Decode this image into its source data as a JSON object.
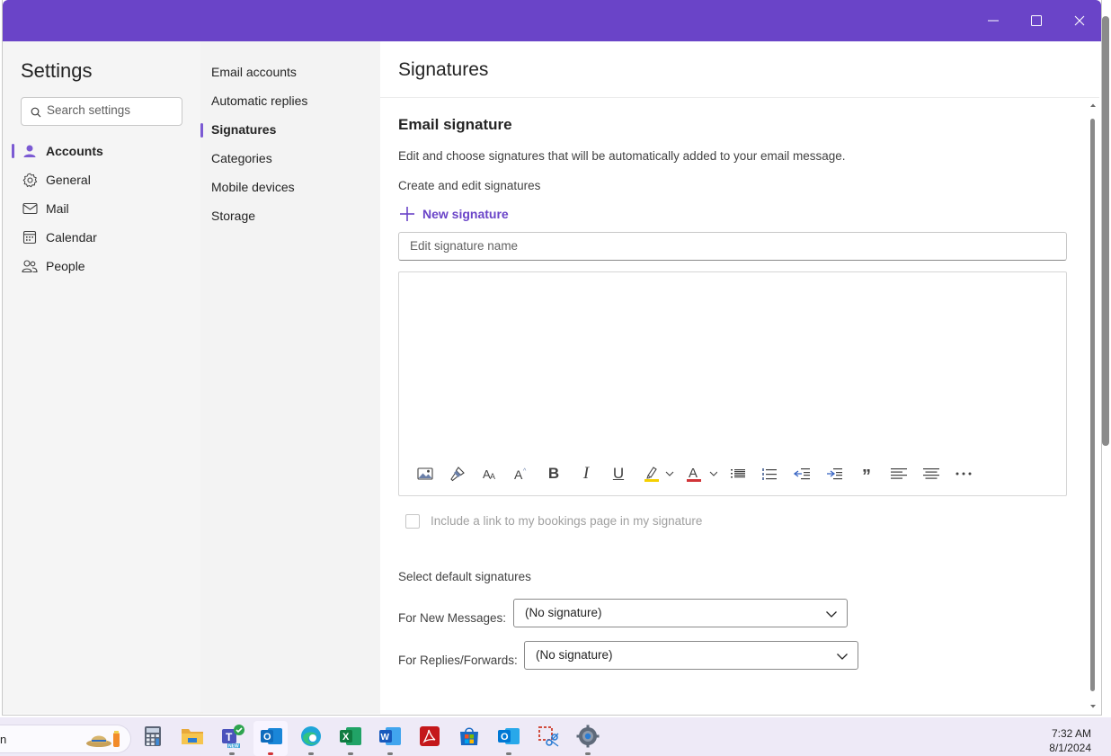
{
  "window": {
    "controls": [
      "minimize",
      "maximize",
      "close"
    ]
  },
  "sidebar": {
    "title": "Settings",
    "search_placeholder": "Search settings",
    "items": [
      {
        "label": "Accounts",
        "icon": "person-icon",
        "active": true
      },
      {
        "label": "General",
        "icon": "gear-icon"
      },
      {
        "label": "Mail",
        "icon": "mail-icon"
      },
      {
        "label": "Calendar",
        "icon": "calendar-icon"
      },
      {
        "label": "People",
        "icon": "people-icon"
      }
    ]
  },
  "subnav": {
    "items": [
      {
        "label": "Email accounts"
      },
      {
        "label": "Automatic replies"
      },
      {
        "label": "Signatures",
        "active": true
      },
      {
        "label": "Categories"
      },
      {
        "label": "Mobile devices"
      },
      {
        "label": "Storage"
      }
    ]
  },
  "main": {
    "title": "Signatures",
    "section_title": "Email signature",
    "description": "Edit and choose signatures that will be automatically added to your email message.",
    "create_label": "Create and edit signatures",
    "new_signature_label": "New signature",
    "name_placeholder": "Edit signature name",
    "toolbar": [
      "insert-image-icon",
      "format-painter-icon",
      "font-size-icon",
      "superscript-icon",
      "bold-icon",
      "italic-icon",
      "underline-icon",
      "highlight-icon",
      "font-color-icon",
      "bullets-icon",
      "numbering-icon",
      "decrease-indent-icon",
      "increase-indent-icon",
      "quote-icon",
      "align-left-icon",
      "align-center-icon",
      "more-options-icon"
    ],
    "bookings_label": "Include a link to my bookings page in my signature",
    "defaults_title": "Select default signatures",
    "new_messages_label": "For New Messages:",
    "new_messages_value": "(No signature)",
    "replies_label": "For Replies/Forwards:",
    "replies_value": "(No signature)"
  },
  "colors": {
    "accent": "#6a44c8",
    "highlight": "#f5d000",
    "font_color": "#d13438"
  },
  "taskbar": {
    "time": "7:32 AM",
    "date": "8/1/2024",
    "search_fragment": "n",
    "apps": [
      "calculator-icon",
      "file-explorer-icon",
      "teams-icon",
      "outlook-new-icon",
      "edge-icon",
      "excel-icon",
      "word-icon",
      "acrobat-icon",
      "store-icon",
      "outlook-icon",
      "snipping-tool-icon",
      "settings-icon"
    ]
  }
}
